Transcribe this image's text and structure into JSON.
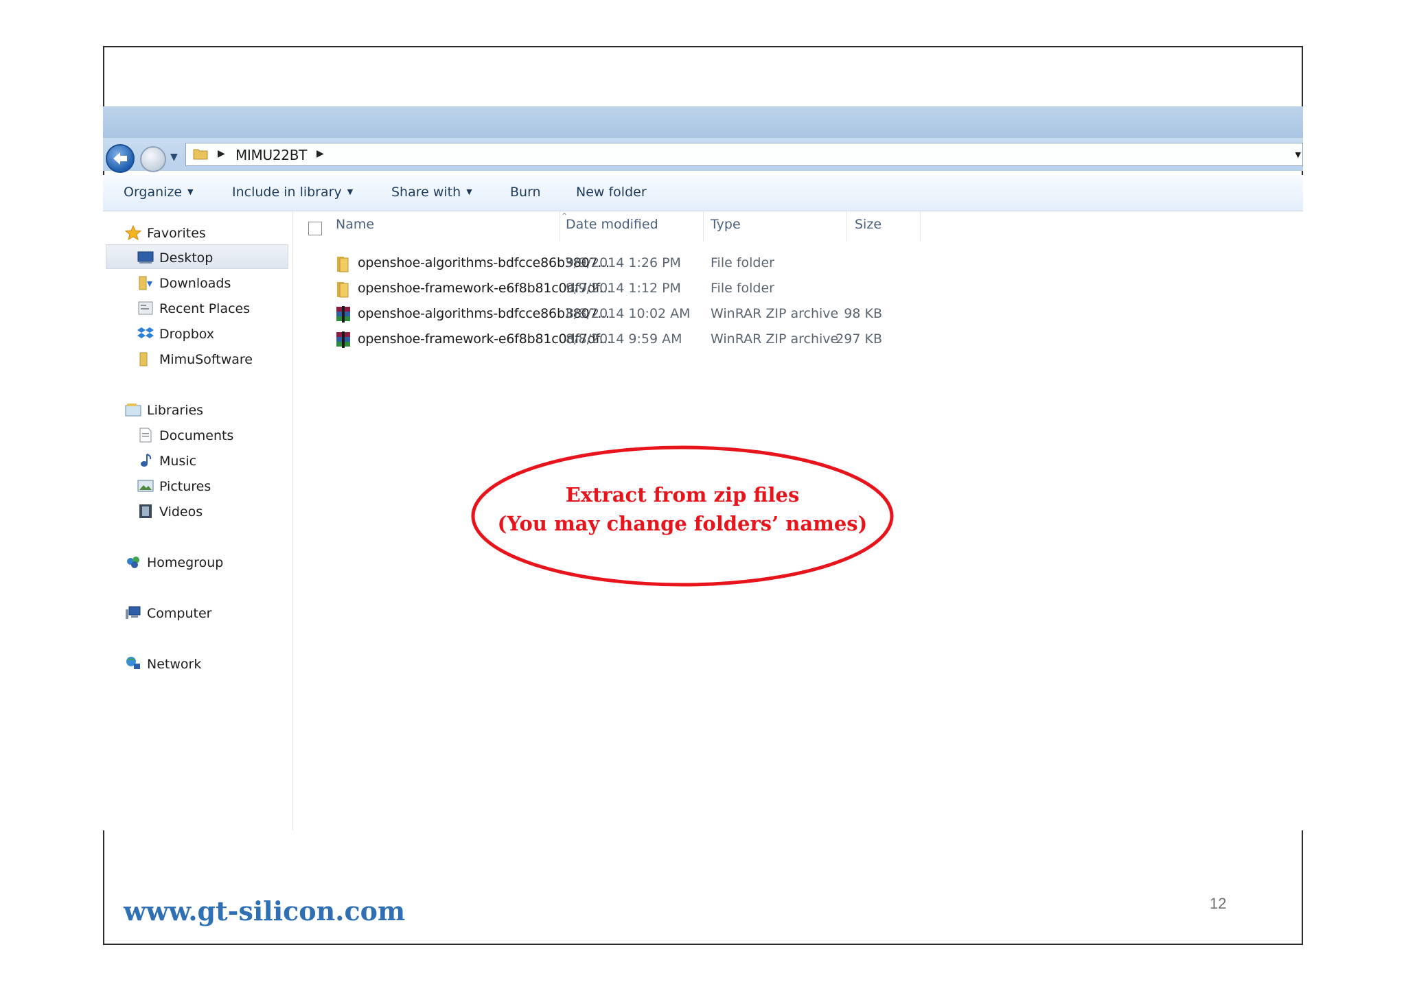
{
  "explorer": {
    "address": {
      "path": "MIMU22BT",
      "separator": "▶"
    },
    "toolbar": {
      "organize": "Organize",
      "include_in_library": "Include in library",
      "share_with": "Share with",
      "burn": "Burn",
      "new_folder": "New folder"
    },
    "nav": {
      "favorites": "Favorites",
      "desktop": "Desktop",
      "downloads": "Downloads",
      "recent_places": "Recent Places",
      "dropbox": "Dropbox",
      "mimusoftware": "MimuSoftware",
      "libraries": "Libraries",
      "documents": "Documents",
      "music": "Music",
      "pictures": "Pictures",
      "videos": "Videos",
      "homegroup": "Homegroup",
      "computer": "Computer",
      "network": "Network"
    },
    "columns": {
      "name": "Name",
      "date_modified": "Date modified",
      "type": "Type",
      "size": "Size"
    },
    "files": [
      {
        "name": "openshoe-algorithms-bdfcce86b3807...",
        "date": "9/9/2014 1:26 PM",
        "type": "File folder",
        "size": "",
        "icon": "folder-icon"
      },
      {
        "name": "openshoe-framework-e6f8b81c0df7df...",
        "date": "9/9/2014 1:12 PM",
        "type": "File folder",
        "size": "",
        "icon": "folder-icon"
      },
      {
        "name": "openshoe-algorithms-bdfcce86b3807...",
        "date": "8/8/2014 10:02 AM",
        "type": "WinRAR ZIP archive",
        "size": "98 KB",
        "icon": "winrar-icon"
      },
      {
        "name": "openshoe-framework-e6f8b81c0df7df...",
        "date": "8/8/2014 9:59 AM",
        "type": "WinRAR ZIP archive",
        "size": "297 KB",
        "icon": "winrar-icon"
      }
    ]
  },
  "callout": {
    "line1": "Extract from zip files",
    "line2": "(You may change folders’ names)"
  },
  "footer": {
    "url": "www.gt-silicon.com",
    "page_number": "12"
  },
  "colors": {
    "callout_red": "#e8141b",
    "footer_blue": "#2f6fb3"
  }
}
